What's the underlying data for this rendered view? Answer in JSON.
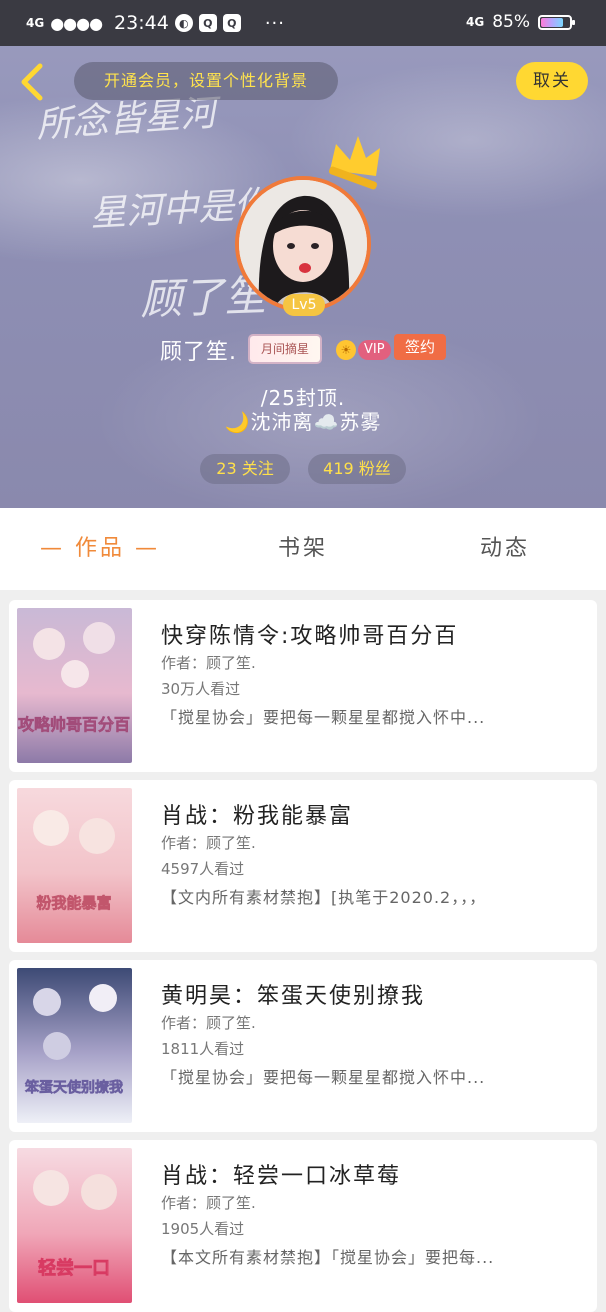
{
  "status_bar": {
    "network_left": "4G",
    "signal": "●●●●",
    "time": "23:44",
    "more": "···",
    "network_right": "4G",
    "battery_percent": "85%",
    "battery_level": 0.85
  },
  "header": {
    "promo_text": "开通会员，设置个性化背景",
    "cancel_label": "取关",
    "background_text": [
      "所念皆星河",
      "星河中是你",
      "顾了笙"
    ],
    "level": "Lv5",
    "username": "顾了笙.",
    "user_tag": "月间摘星",
    "vip_label": "VIP",
    "sign_label": "签约",
    "bio_line1": "/25封顶.",
    "bio_line2": "🌙沈沛离☁️苏雾",
    "following": "23 关注",
    "fans": "419 粉丝"
  },
  "tabs": [
    {
      "label": "— 作品 —",
      "active": true
    },
    {
      "label": "书架",
      "active": false
    },
    {
      "label": "动态",
      "active": false
    }
  ],
  "books": [
    {
      "title": "快穿陈情令:攻略帅哥百分百",
      "author": "作者：顾了笙.",
      "views": "30万人看过",
      "desc": "「搅星协会」要把每一颗星星都搅入怀中...",
      "cover_text": "攻略帅哥百分百",
      "cover_colors": [
        "#c9b9d6",
        "#e7b9cf",
        "#8d7aa8"
      ]
    },
    {
      "title": "肖战：粉我能暴富",
      "author": "作者：顾了笙.",
      "views": "4597人看过",
      "desc": "【文内所有素材禁抱】[执笔于2020.2，，，",
      "cover_text": "粉我能暴富",
      "cover_colors": [
        "#f7d9dd",
        "#f2c3c9",
        "#e58a98"
      ]
    },
    {
      "title": "黄明昊：笨蛋天使别撩我",
      "author": "作者：顾了笙.",
      "views": "1811人看过",
      "desc": "「搅星协会」要把每一颗星星都搅入怀中...",
      "cover_text": "笨蛋天使别撩我",
      "cover_colors": [
        "#3d4a75",
        "#a7a2c8",
        "#eef0f7"
      ]
    },
    {
      "title": "肖战：轻尝一口冰草莓",
      "author": "作者：顾了笙.",
      "views": "1905人看过",
      "desc": "【本文所有素材禁抱】「搅星协会」要把每...",
      "cover_text": "轻尝一口",
      "cover_colors": [
        "#f6dbe2",
        "#f0a7b8",
        "#e04f74"
      ]
    }
  ]
}
